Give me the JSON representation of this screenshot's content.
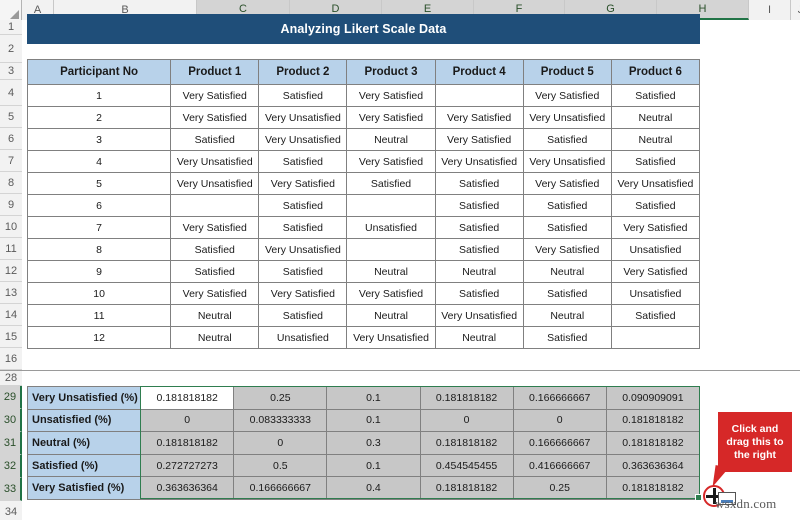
{
  "app": {
    "type": "spreadsheet",
    "watermark": "wsxdn.com"
  },
  "colors": {
    "title_banner_bg": "#1f4e79",
    "table_header_bg": "#b8d2ea",
    "summary_value_bg": "#c7c7c7",
    "selection_border": "#2f7d4f",
    "callout_bg": "#d62828",
    "grid_line": "#808080"
  },
  "column_headers": [
    {
      "label": "A",
      "width": 32,
      "selected": false
    },
    {
      "label": "B",
      "width": 143,
      "selected": false
    },
    {
      "label": "C",
      "width": 93,
      "selected": true
    },
    {
      "label": "D",
      "width": 92,
      "selected": true
    },
    {
      "label": "E",
      "width": 92,
      "selected": true
    },
    {
      "label": "F",
      "width": 91,
      "selected": true
    },
    {
      "label": "G",
      "width": 92,
      "selected": true
    },
    {
      "label": "H",
      "width": 92,
      "selected": true
    },
    {
      "label": "I",
      "width": 42,
      "selected": false
    },
    {
      "label": "J",
      "width": 20,
      "selected": false
    }
  ],
  "row_headers": [
    {
      "label": "1",
      "height": 15,
      "selected": false
    },
    {
      "label": "2",
      "height": 28,
      "selected": false
    },
    {
      "label": "3",
      "height": 17,
      "selected": false
    },
    {
      "label": "4",
      "height": 26,
      "selected": false
    },
    {
      "label": "5",
      "height": 22,
      "selected": false
    },
    {
      "label": "6",
      "height": 22,
      "selected": false
    },
    {
      "label": "7",
      "height": 22,
      "selected": false
    },
    {
      "label": "8",
      "height": 22,
      "selected": false
    },
    {
      "label": "9",
      "height": 22,
      "selected": false
    },
    {
      "label": "10",
      "height": 22,
      "selected": false
    },
    {
      "label": "11",
      "height": 22,
      "selected": false
    },
    {
      "label": "12",
      "height": 22,
      "selected": false
    },
    {
      "label": "13",
      "height": 22,
      "selected": false
    },
    {
      "label": "14",
      "height": 22,
      "selected": false
    },
    {
      "label": "15",
      "height": 22,
      "selected": false
    },
    {
      "label": "16",
      "height": 22,
      "selected": false
    },
    {
      "label": "28",
      "height": 16,
      "selected": false
    },
    {
      "label": "29",
      "height": 23,
      "selected": true
    },
    {
      "label": "30",
      "height": 23,
      "selected": true
    },
    {
      "label": "31",
      "height": 23,
      "selected": true
    },
    {
      "label": "32",
      "height": 23,
      "selected": true
    },
    {
      "label": "33",
      "height": 23,
      "selected": true
    },
    {
      "label": "34",
      "height": 22,
      "selected": false
    }
  ],
  "title": {
    "text": "Analyzing Likert Scale Data"
  },
  "main_table": {
    "headers": [
      "Participant No",
      "Product 1",
      "Product 2",
      "Product 3",
      "Product 4",
      "Product 5",
      "Product 6"
    ],
    "rows": [
      [
        "1",
        "Very Satisfied",
        "Satisfied",
        "Very Satisfied",
        "",
        "Very Satisfied",
        "Satisfied"
      ],
      [
        "2",
        "Very Satisfied",
        "Very Unsatisfied",
        "Very Satisfied",
        "Very Satisfied",
        "Very Unsatisfied",
        "Neutral"
      ],
      [
        "3",
        "Satisfied",
        "Very Unsatisfied",
        "Neutral",
        "Very Satisfied",
        "Satisfied",
        "Neutral"
      ],
      [
        "4",
        "Very Unsatisfied",
        "Satisfied",
        "Very Satisfied",
        "Very Unsatisfied",
        "Very Unsatisfied",
        "Satisfied"
      ],
      [
        "5",
        "Very Unsatisfied",
        "Very Satisfied",
        "Satisfied",
        "Satisfied",
        "Very Satisfied",
        "Very Unsatisfied"
      ],
      [
        "6",
        "",
        "Satisfied",
        "",
        "Satisfied",
        "Satisfied",
        "Satisfied"
      ],
      [
        "7",
        "Very Satisfied",
        "Satisfied",
        "Unsatisfied",
        "Satisfied",
        "Satisfied",
        "Very Satisfied"
      ],
      [
        "8",
        "Satisfied",
        "Very Unsatisfied",
        "",
        "Satisfied",
        "Very Satisfied",
        "Unsatisfied"
      ],
      [
        "9",
        "Satisfied",
        "Satisfied",
        "Neutral",
        "Neutral",
        "Neutral",
        "Very Satisfied"
      ],
      [
        "10",
        "Very Satisfied",
        "Very Satisfied",
        "Very Satisfied",
        "Satisfied",
        "Satisfied",
        "Unsatisfied"
      ],
      [
        "11",
        "Neutral",
        "Satisfied",
        "Neutral",
        "Very Unsatisfied",
        "Neutral",
        "Satisfied"
      ],
      [
        "12",
        "Neutral",
        "Unsatisfied",
        "Very Unsatisfied",
        "Neutral",
        "Satisfied",
        ""
      ]
    ]
  },
  "summary_table": {
    "rows": [
      {
        "label": "Very Unsatisfied (%)",
        "values": [
          "0.181818182",
          "0.25",
          "0.1",
          "0.181818182",
          "0.166666667",
          "0.090909091"
        ]
      },
      {
        "label": "Unsatisfied (%)",
        "values": [
          "0",
          "0.083333333",
          "0.1",
          "0",
          "0",
          "0.181818182"
        ]
      },
      {
        "label": "Neutral (%)",
        "values": [
          "0.181818182",
          "0",
          "0.3",
          "0.181818182",
          "0.166666667",
          "0.181818182"
        ]
      },
      {
        "label": "Satisfied (%)",
        "values": [
          "0.272727273",
          "0.5",
          "0.1",
          "0.454545455",
          "0.416666667",
          "0.363636364"
        ]
      },
      {
        "label": "Very Satisfied (%)",
        "values": [
          "0.363636364",
          "0.166666667",
          "0.4",
          "0.181818182",
          "0.25",
          "0.181818182"
        ]
      }
    ],
    "active_cell_row": 0,
    "active_cell_col": 0
  },
  "callout": {
    "text": "Click and drag this to the right"
  },
  "chart_data": {
    "type": "table",
    "title": "Analyzing Likert Scale Data",
    "categories": [
      "Product 1",
      "Product 2",
      "Product 3",
      "Product 4",
      "Product 5",
      "Product 6"
    ],
    "series": [
      {
        "name": "Very Unsatisfied (%)",
        "values": [
          0.181818182,
          0.25,
          0.1,
          0.181818182,
          0.166666667,
          0.090909091
        ]
      },
      {
        "name": "Unsatisfied (%)",
        "values": [
          0,
          0.083333333,
          0.1,
          0,
          0,
          0.181818182
        ]
      },
      {
        "name": "Neutral (%)",
        "values": [
          0.181818182,
          0,
          0.3,
          0.181818182,
          0.166666667,
          0.181818182
        ]
      },
      {
        "name": "Satisfied (%)",
        "values": [
          0.272727273,
          0.5,
          0.1,
          0.454545455,
          0.416666667,
          0.363636364
        ]
      },
      {
        "name": "Very Satisfied (%)",
        "values": [
          0.363636364,
          0.166666667,
          0.4,
          0.181818182,
          0.25,
          0.181818182
        ]
      }
    ],
    "xlabel": "",
    "ylabel": "",
    "grid": true,
    "legend": "left-column"
  }
}
